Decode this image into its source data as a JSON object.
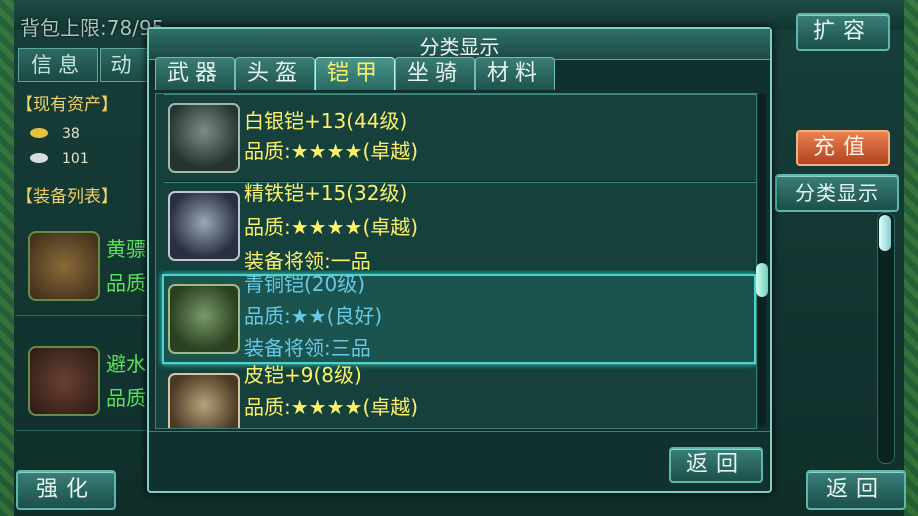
{
  "background": {
    "bag_limit_label": "背包上限:",
    "bag_limit_value": "78/95",
    "expand_button": "扩容",
    "side_tab_info": "信息",
    "side_tab_second": "动",
    "assets_title": "【现有资产】",
    "gold_amount": "38",
    "silver_amount": "101",
    "equip_list_title": "【装备列表】",
    "equip_items": [
      {
        "name": "黄骠",
        "quality": "品质"
      },
      {
        "name": "避水",
        "quality": "品质"
      }
    ],
    "recharge_button": "充值",
    "classify_button": "分类显示",
    "enhance_button": "强化",
    "back_button": "返回"
  },
  "modal": {
    "title": "分类显示",
    "tabs": [
      {
        "label": "武器",
        "active": false
      },
      {
        "label": "头盔",
        "active": false
      },
      {
        "label": "铠甲",
        "active": true
      },
      {
        "label": "坐骑",
        "active": false
      },
      {
        "label": "材料",
        "active": false
      }
    ],
    "items": [
      {
        "name": "白银铠+13(44级)",
        "quality": "品质:★★★★(卓越)",
        "extra": "",
        "icon": "silver-armor-icon"
      },
      {
        "name": "精铁铠+15(32级)",
        "quality": "品质:★★★★(卓越)",
        "extra": "装备将领:一品",
        "icon": "iron-armor-icon"
      },
      {
        "name": "青铜铠(20级)",
        "quality": "品质:★★(良好)",
        "extra": "装备将领:三品",
        "icon": "bronze-armor-icon"
      },
      {
        "name": "皮铠+9(8级)",
        "quality": "品质:★★★★(卓越)",
        "extra": "",
        "icon": "leather-armor-icon"
      }
    ],
    "back_button": "返回"
  },
  "colors": {
    "accent_yellow": "#fbf16a",
    "accent_cyan": "#69c8e6",
    "selection_glow": "#43d9d0"
  }
}
